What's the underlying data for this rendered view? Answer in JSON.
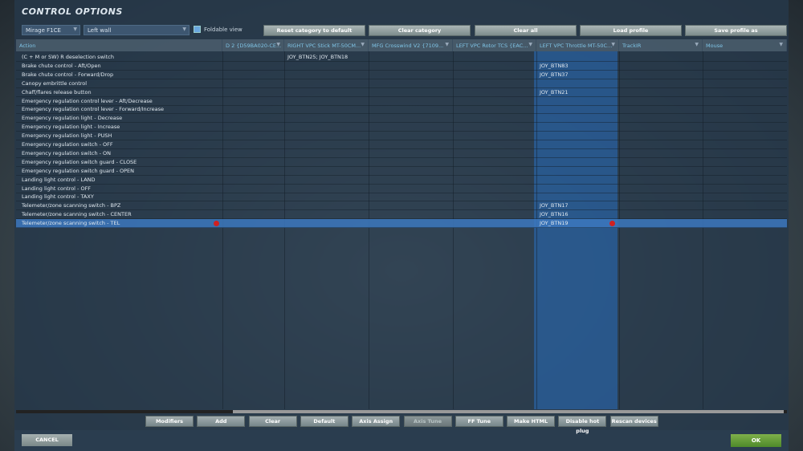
{
  "title": "CONTROL OPTIONS",
  "aircraft_select": "Mirage F1CE",
  "category_select": "Left wall",
  "foldable_view": {
    "label": "Foldable view",
    "checked": true
  },
  "top_buttons": [
    "Reset category to default",
    "Clear category",
    "Clear all",
    "Load profile",
    "Save profile as"
  ],
  "columns": [
    "Action",
    "D 2 {D59BA020-CE...",
    "RIGHT VPC Stick MT-50CM...",
    "MFG Crosswind V2 {7109...",
    "LEFT VPC Rotor TCS {EAC...",
    "LEFT VPC Throttle MT-50C...",
    "TrackIR",
    "Mouse"
  ],
  "highlighted_column": "LEFT VPC Throttle MT-50C...",
  "rows": [
    {
      "action": "(C + M or SW) R deselection switch",
      "b2": "JOY_BTN25; JOY_BTN18",
      "b5": ""
    },
    {
      "action": "Brake chute control - Aft/Open",
      "b2": "",
      "b5": "JOY_BTN83"
    },
    {
      "action": "Brake chute control - Forward/Drop",
      "b2": "",
      "b5": "JOY_BTN37"
    },
    {
      "action": "Canopy embrittle control",
      "b2": "",
      "b5": ""
    },
    {
      "action": "Chaff/flares release button",
      "b2": "",
      "b5": "JOY_BTN21"
    },
    {
      "action": "Emergency regulation control lever - Aft/Decrease",
      "b2": "",
      "b5": ""
    },
    {
      "action": "Emergency regulation control lever - Forward/Increase",
      "b2": "",
      "b5": ""
    },
    {
      "action": "Emergency regulation light - Decrease",
      "b2": "",
      "b5": ""
    },
    {
      "action": "Emergency regulation light - Increase",
      "b2": "",
      "b5": ""
    },
    {
      "action": "Emergency regulation light - PUSH",
      "b2": "",
      "b5": ""
    },
    {
      "action": "Emergency regulation switch - OFF",
      "b2": "",
      "b5": ""
    },
    {
      "action": "Emergency regulation switch - ON",
      "b2": "",
      "b5": ""
    },
    {
      "action": "Emergency regulation switch guard - CLOSE",
      "b2": "",
      "b5": ""
    },
    {
      "action": "Emergency regulation switch guard - OPEN",
      "b2": "",
      "b5": ""
    },
    {
      "action": "Landing light control - LAND",
      "b2": "",
      "b5": ""
    },
    {
      "action": "Landing light control - OFF",
      "b2": "",
      "b5": ""
    },
    {
      "action": "Landing light control - TAXY",
      "b2": "",
      "b5": ""
    },
    {
      "action": "Telemeter/zone scanning switch - BPZ",
      "b2": "",
      "b5": "JOY_BTN17"
    },
    {
      "action": "Telemeter/zone scanning switch - CENTER",
      "b2": "",
      "b5": "JOY_BTN16"
    },
    {
      "action": "Telemeter/zone scanning switch - TEL",
      "b2": "",
      "b5": "JOY_BTN19",
      "selected": true
    }
  ],
  "bottom_buttons": [
    {
      "label": "Modifiers"
    },
    {
      "label": "Add"
    },
    {
      "label": "Clear"
    },
    {
      "label": "Default"
    },
    {
      "label": "Axis Assign"
    },
    {
      "label": "Axis Tune",
      "disabled": true
    },
    {
      "label": "FF Tune"
    },
    {
      "label": "Make HTML"
    },
    {
      "label": "Disable hot plug"
    },
    {
      "label": "Rescan devices"
    }
  ],
  "cancel": "CANCEL",
  "ok": "OK",
  "colors": {
    "accent": "#7fc4e6",
    "highlight_column": "#286ebe",
    "ok": "#5e9a36",
    "conflict_dot": "#d02020"
  }
}
